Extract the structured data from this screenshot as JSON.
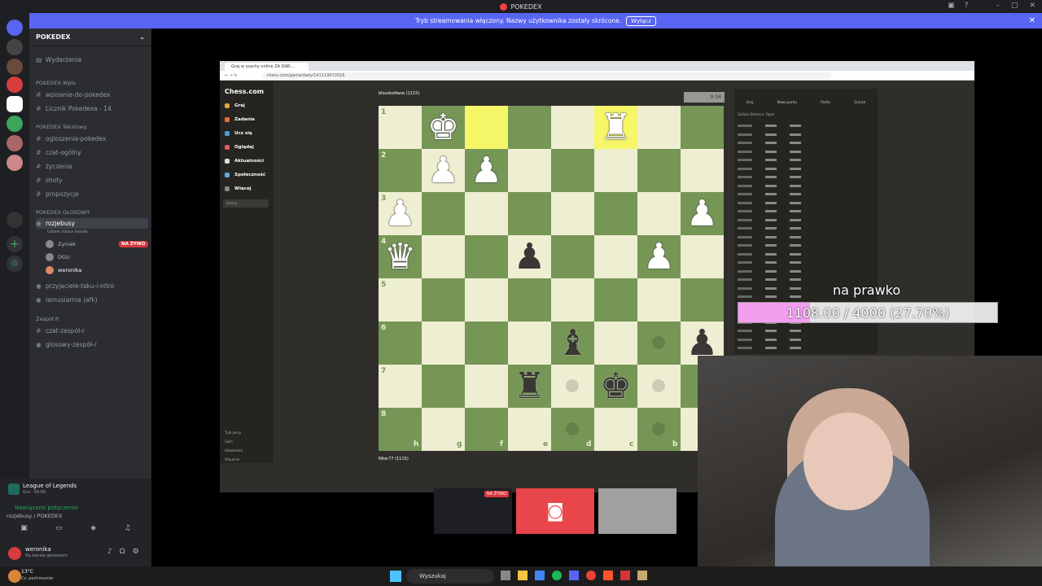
{
  "window": {
    "title": "POKEDEX"
  },
  "banner": {
    "text": "Tryb streamowania włączony. Nazwy użytkownika zostały skrócone.",
    "button": "Wyłącz"
  },
  "server": {
    "name": "POKEDEX",
    "events": "Wydarzenia"
  },
  "categories": [
    {
      "name": "POKEDEX Wpis",
      "channels": [
        "wpisanie-do-pokedex",
        "Licznik Pokedexa - 14"
      ]
    },
    {
      "name": "POKEDEX Tekstowy",
      "channels": [
        "ogloszenia-pokedex",
        "czat-ogólny",
        "życzenia",
        "shoty",
        "propozycje"
      ]
    },
    {
      "name": "POKEDEX GŁOSOWY",
      "channels": [
        "rozjebusy",
        "przyjaciele-taku-i-nitro",
        "lamusiarnia (afk)"
      ]
    },
    {
      "name": "Zespół R",
      "channels": [
        "czat-zespół-r",
        "glosowy-zespół-r"
      ]
    }
  ],
  "active_channel": {
    "status": "Ustaw status kanału",
    "live": "NA ŻYWO",
    "users": [
      "Zyniak",
      "DGU",
      "weronika"
    ]
  },
  "activity": {
    "game": "League of Legends",
    "game_time": "Gra · 56:00",
    "connection": "Nawiązano połączenie",
    "channel_path": "rozjebusy / POKEDEX"
  },
  "user": {
    "name": "weronika",
    "status": "Na kanale głosowym"
  },
  "taskbar": {
    "temp": "13°C",
    "weather": "Cz. pochmurnie",
    "search": "Wyszukaj"
  },
  "browser": {
    "tab": "Graj w szachy online ZA DAR...",
    "url": "chess.com/game/daily/141119072016"
  },
  "chess_nav": {
    "logo": "Chess.com",
    "items": [
      "Graj",
      "Zadania",
      "Ucz się",
      "Oglądaj",
      "Aktualności",
      "Społeczność",
      "Więcej"
    ],
    "search": "Szukaj",
    "bottom": [
      "Tryb jasny",
      "Zwiń",
      "Ustawienia",
      "Wsparcie"
    ]
  },
  "players": {
    "top": "bloudsofiane (1115)",
    "bottom": "Niter77 (1115)",
    "clock": "0:34"
  },
  "ranks": [
    "1",
    "2",
    "3",
    "4",
    "5",
    "6",
    "7",
    "8"
  ],
  "files": [
    "h",
    "g",
    "f",
    "e",
    "d",
    "c",
    "b"
  ],
  "move_panel": {
    "tabs": [
      "Graj",
      "Nowa partia",
      "Partie",
      "Gracze"
    ],
    "opening": "Sizilian Defence: Open"
  },
  "goal_overlay": {
    "label": "na prawko",
    "text": "1108.00 / 4000 (27.70%)",
    "progress": 0.277
  },
  "thumbnails": {
    "live": "NA ŻYWO"
  },
  "colors": {
    "light": "#eeeed2",
    "dark": "#769656",
    "highlight": "#f6f669",
    "accent": "#5865f2",
    "progress": "#f49ef0"
  }
}
